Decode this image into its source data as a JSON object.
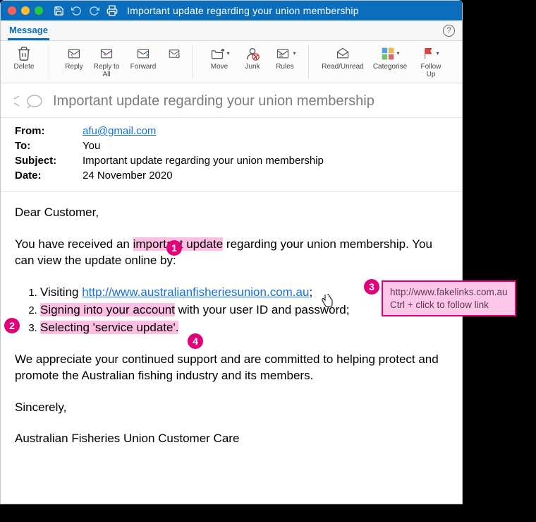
{
  "titlebar": {
    "title": "Important update regarding your union membership"
  },
  "menubar": {
    "tab": "Message"
  },
  "ribbon": {
    "delete": "Delete",
    "reply": "Reply",
    "replyAll": "Reply to All",
    "forward": "Forward",
    "move": "Move",
    "junk": "Junk",
    "rules": "Rules",
    "readUnread": "Read/Unread",
    "categorise": "Categorise",
    "followUp": "Follow Up"
  },
  "subject": "Important update regarding your union membership",
  "headers": {
    "fromLabel": "From:",
    "from": "afu@gmail.com",
    "toLabel": "To:",
    "to": "You",
    "subjectLabel": "Subject:",
    "subject": "Important update regarding your union membership",
    "dateLabel": "Date:",
    "date": "24 November 2020"
  },
  "body": {
    "greeting": "Dear Customer,",
    "intro1": "You have received an ",
    "intro_hl": "important update",
    "intro2": " regarding your union membership. You can view the update online by:",
    "steps_pre1": "Visiting ",
    "step1_link": "http://www.australianfisheriesunion.com.au",
    "step1_post": ";",
    "step2_hl": "Signing into your account",
    "step2_post": " with your user ID and password;",
    "step3_hl": "Selecting 'service update'.",
    "closing1": "We appreciate your continued support and are committed to helping protect and promote the Australian fishing industry and its members.",
    "signoff": "Sincerely,",
    "signature": "Australian Fisheries Union Customer Care"
  },
  "annotations": {
    "b1": "1",
    "b2": "2",
    "b3": "3",
    "b4": "4",
    "tooltip_url": "http://www.fakelinks.com.au",
    "tooltip_hint": "Ctrl + click to follow link"
  }
}
